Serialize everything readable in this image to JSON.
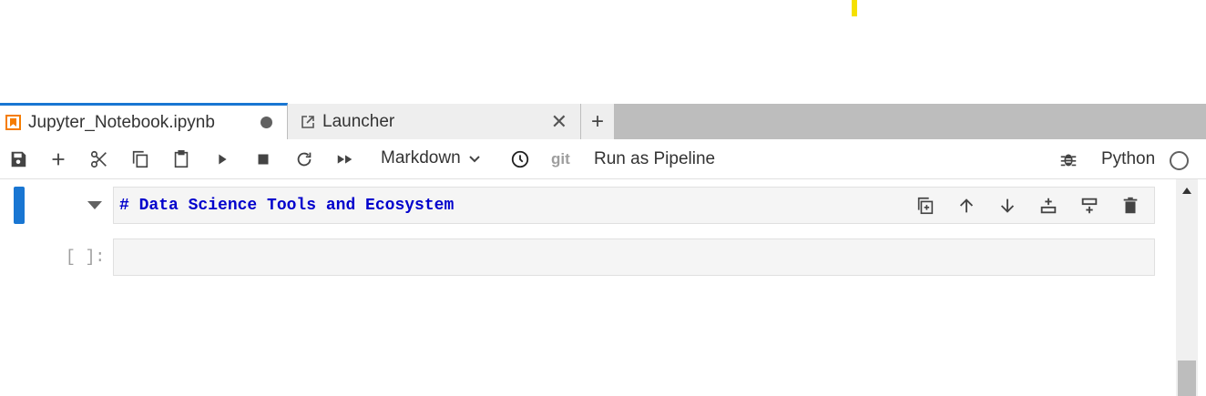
{
  "tabs": [
    {
      "label": "Jupyter_Notebook.ipynb",
      "active": true,
      "icon": "notebook-icon",
      "dirty": true
    },
    {
      "label": "Launcher",
      "active": false,
      "icon": "external-link-icon",
      "close": "✕"
    }
  ],
  "add_tab_label": "+",
  "toolbar": {
    "buttons": [
      "save-icon",
      "add-cell-icon",
      "cut-icon",
      "copy-icon",
      "paste-icon",
      "run-icon",
      "stop-icon",
      "restart-icon",
      "fast-forward-icon"
    ],
    "cell_type": "Markdown",
    "git_label": "git",
    "pipeline_label": "Run as Pipeline",
    "kernel_name": "Python"
  },
  "cells": [
    {
      "type": "markdown",
      "source": "# Data Science Tools and Ecosystem"
    },
    {
      "type": "code",
      "prompt": "[ ]:",
      "source": ""
    }
  ],
  "cell_toolbar": [
    "duplicate-icon",
    "move-up-icon",
    "move-down-icon",
    "insert-above-icon",
    "insert-below-icon",
    "delete-icon"
  ],
  "colors": {
    "accent": "#1976d2",
    "notebook_icon": "#f57c00",
    "markdown_text": "#0000cc"
  }
}
